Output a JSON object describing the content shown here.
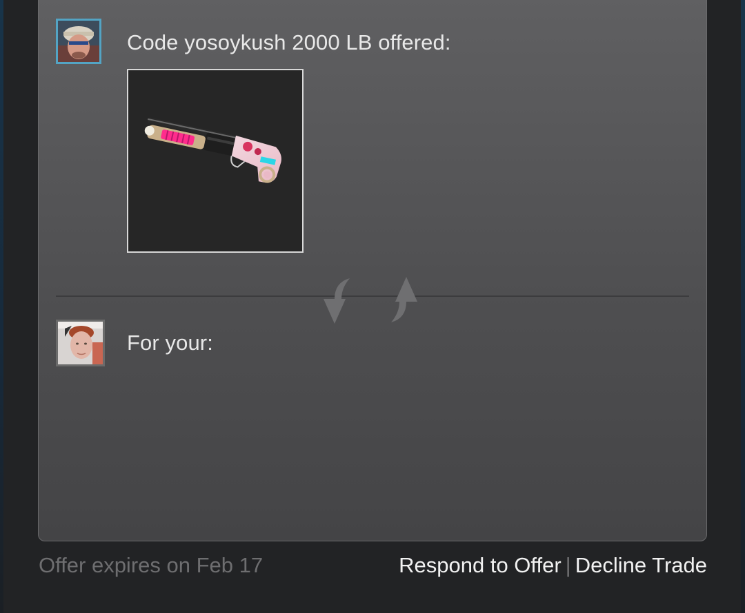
{
  "offer": {
    "them_heading": "Code yosoykush 2000 LB offered:",
    "me_heading": "For your:",
    "item": {
      "type": "shotgun skin",
      "icon": "shotgun-item-icon"
    },
    "swap_icon": "trade-arrows-icon"
  },
  "footer": {
    "expires_text": "Offer expires on Feb 17",
    "respond_label": "Respond to Offer",
    "separator": "|",
    "decline_label": "Decline Trade"
  },
  "colors": {
    "avatar_border_them": "#53a4c4",
    "avatar_border_me": "#6b6b6b",
    "muted_text": "#6e6e70",
    "primary_text": "#e8e8e8"
  }
}
